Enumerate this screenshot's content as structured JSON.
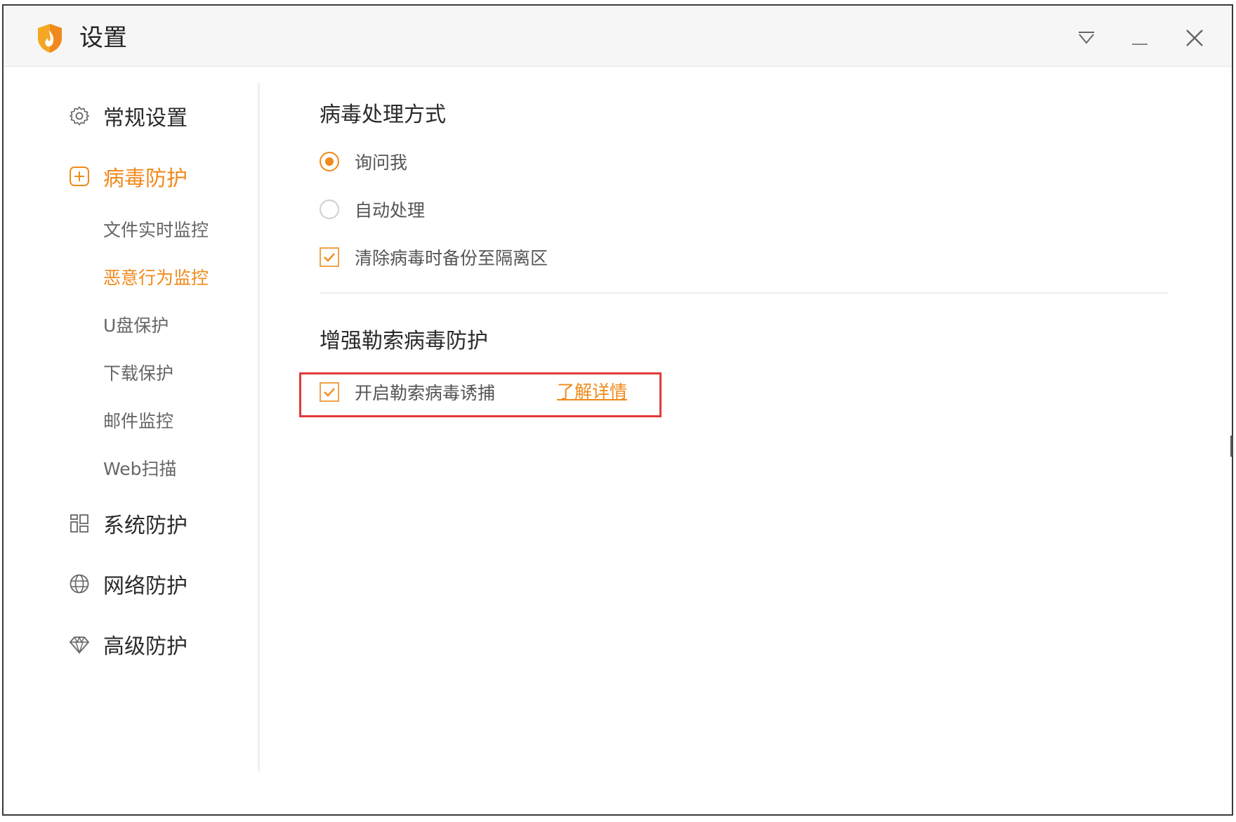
{
  "window": {
    "title": "设置",
    "controls": {
      "menu_icon": "dropdown-triangle-icon",
      "minimize_icon": "minimize-icon",
      "close_icon": "close-icon"
    }
  },
  "sidebar": {
    "items": [
      {
        "label": "常规设置",
        "icon": "gear-icon",
        "active": false
      },
      {
        "label": "病毒防护",
        "icon": "plus-square-icon",
        "active": true,
        "children": [
          {
            "label": "文件实时监控",
            "active": false
          },
          {
            "label": "恶意行为监控",
            "active": true
          },
          {
            "label": "U盘保护",
            "active": false
          },
          {
            "label": "下载保护",
            "active": false
          },
          {
            "label": "邮件监控",
            "active": false
          },
          {
            "label": "Web扫描",
            "active": false
          }
        ]
      },
      {
        "label": "系统防护",
        "icon": "grid-blocks-icon",
        "active": false
      },
      {
        "label": "网络防护",
        "icon": "globe-icon",
        "active": false
      },
      {
        "label": "高级防护",
        "icon": "diamond-icon",
        "active": false
      }
    ]
  },
  "main": {
    "virus_handling": {
      "title": "病毒处理方式",
      "radio_ask": {
        "label": "询问我",
        "checked": true
      },
      "radio_auto": {
        "label": "自动处理",
        "checked": false
      },
      "checkbox_backup": {
        "label": "清除病毒时备份至隔离区",
        "checked": true
      }
    },
    "ransomware": {
      "title": "增强勒索病毒防护",
      "checkbox_trap": {
        "label": "开启勒索病毒诱捕",
        "checked": true
      },
      "learn_more": "了解详情"
    }
  },
  "colors": {
    "accent": "#f08a1c",
    "highlight_border": "#e33a3a",
    "text_primary": "#2a2a2a",
    "text_secondary": "#666666"
  }
}
